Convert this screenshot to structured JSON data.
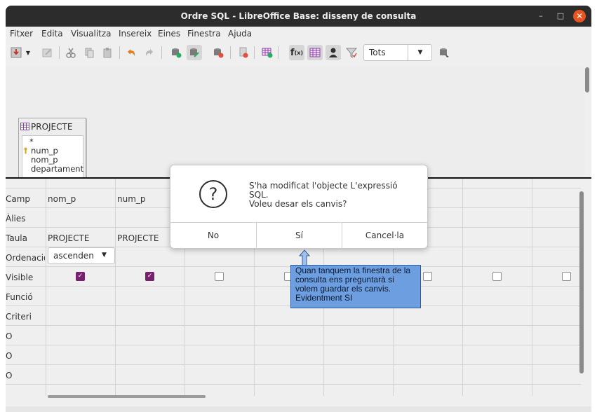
{
  "window": {
    "title": "Ordre SQL - LibreOffice Base: disseny de consulta",
    "minimize_icon": "–",
    "maximize_icon": "□",
    "close_icon": "✕"
  },
  "menu": [
    "Fitxer",
    "Edita",
    "Visualitza",
    "Insereix",
    "Eines",
    "Finestra",
    "Ajuda"
  ],
  "toolbar": {
    "limit_value": "Tots"
  },
  "query_table": {
    "name": "PROJECTE",
    "fields": [
      "*",
      "num_p",
      "nom_p",
      "departament"
    ]
  },
  "grid": {
    "row_labels": [
      "Camp",
      "Àlies",
      "Taula",
      "Ordenació",
      "Visible",
      "Funció",
      "Criteri",
      "O",
      "O",
      "O"
    ],
    "columns": [
      {
        "camp": "nom_p",
        "taula": "PROJECTE",
        "ordenacio": "ascenden",
        "visible": true
      },
      {
        "camp": "num_p",
        "taula": "PROJECTE",
        "ordenacio": "",
        "visible": true
      },
      {
        "camp": "",
        "taula": "",
        "ordenacio": "",
        "visible": false
      },
      {
        "camp": "",
        "taula": "",
        "ordenacio": "",
        "visible": false
      },
      {
        "camp": "",
        "taula": "",
        "ordenacio": "",
        "visible": false
      },
      {
        "camp": "",
        "taula": "",
        "ordenacio": "",
        "visible": false
      },
      {
        "camp": "",
        "taula": "",
        "ordenacio": "",
        "visible": false
      },
      {
        "camp": "",
        "taula": "",
        "ordenacio": "",
        "visible": false
      }
    ]
  },
  "dialog": {
    "message_line1": "S'ha modificat l'objecte L'expressió SQL.",
    "message_line2": "Voleu desar els canvis?",
    "btn_no": "No",
    "btn_yes": "Sí",
    "btn_cancel": "Cancel·la"
  },
  "callout": {
    "text": "Quan tanquem la finestra de la consulta ens preguntarà si volem guardar els canvis. Evidentment SI"
  },
  "colors": {
    "accent_check": "#77216f",
    "close_button": "#e95420",
    "callout_fill": "#6d9ee0"
  }
}
